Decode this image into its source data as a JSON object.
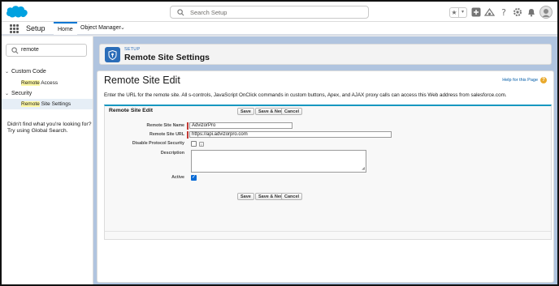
{
  "header": {
    "search_placeholder": "Search Setup",
    "favorites_star": "★",
    "favorites_chevron": "▾"
  },
  "appnav": {
    "app_name": "Setup",
    "tabs": [
      {
        "label": "Home"
      },
      {
        "label": "Object Manager"
      }
    ],
    "object_manager_chevron": "⌄"
  },
  "sidebar": {
    "quick_find_value": "remote",
    "sections": [
      {
        "label": "Custom Code",
        "items": [
          {
            "prefix": "Remote",
            "rest": " Access"
          }
        ]
      },
      {
        "label": "Security",
        "items": [
          {
            "prefix": "Remote",
            "rest": " Site Settings"
          }
        ]
      }
    ],
    "no_results_line1": "Didn't find what you're looking for?",
    "no_results_line2": "Try using Global Search."
  },
  "page_header": {
    "breadcrumb": "SETUP",
    "title": "Remote Site Settings"
  },
  "edit": {
    "title": "Remote Site Edit",
    "help_link": "Help for this Page",
    "intro": "Enter the URL for the remote site. All s-controls, JavaScript OnClick commands in custom buttons, Apex, and AJAX proxy calls can access this Web address from salesforce.com.",
    "form_title": "Remote Site Edit",
    "buttons": {
      "save": "Save",
      "save_new": "Save & New",
      "cancel": "Cancel"
    },
    "fields": {
      "name_label": "Remote Site Name",
      "name_value": "AdvizorPro",
      "url_label": "Remote Site URL",
      "url_value": "https://api.advizorpro.com",
      "disable_label": "Disable Protocol Security",
      "disable_info": "i",
      "description_label": "Description",
      "active_label": "Active",
      "active_check": "✓"
    }
  },
  "colors": {
    "brand": "#00a1e0",
    "accent": "#0176d3",
    "content_bg": "#b0c4df",
    "required": "#c23934"
  }
}
